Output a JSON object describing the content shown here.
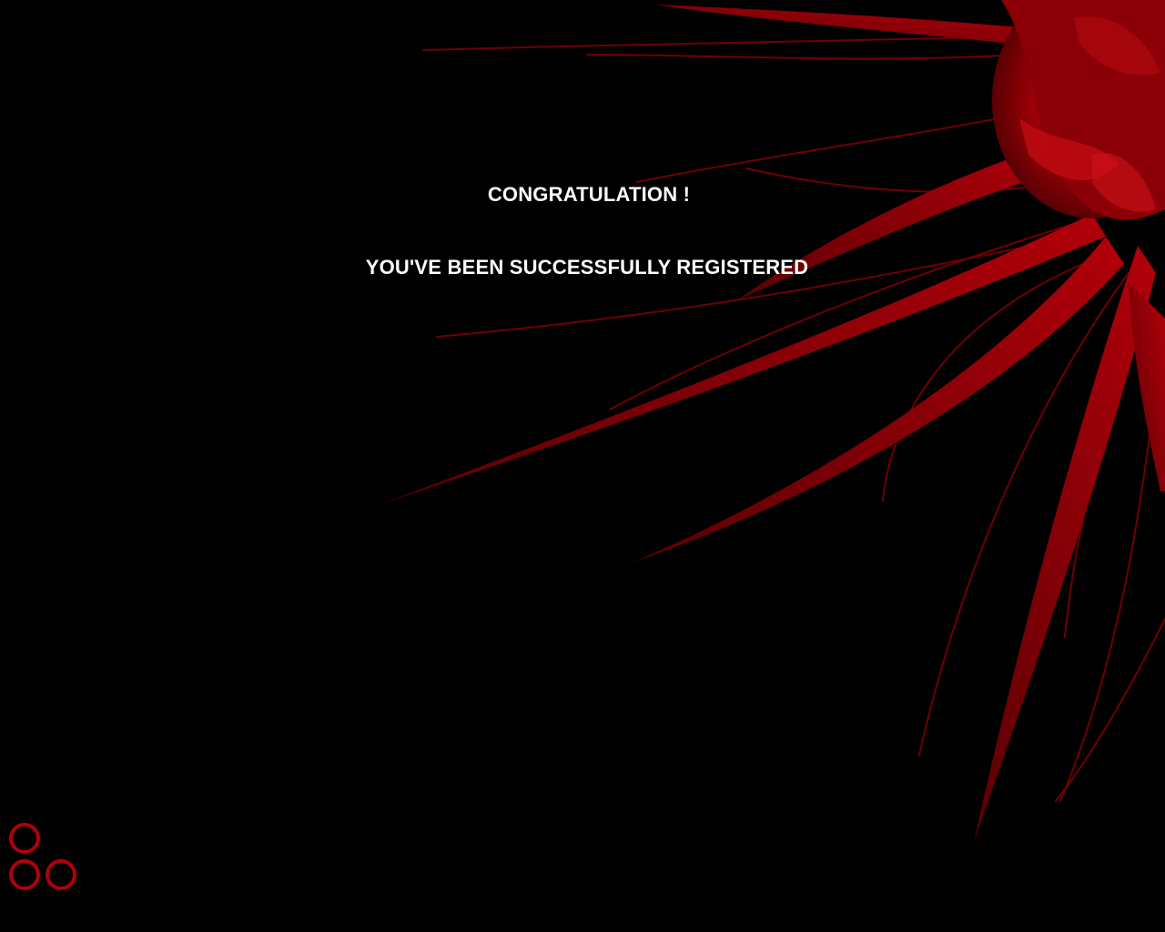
{
  "message": {
    "title": "CONGRATULATION !",
    "subtitle": "YOU'VE BEEN SUCCESSFULLY REGISTERED"
  },
  "colors": {
    "background": "#000000",
    "text": "#ffffff",
    "accent": "#c0000a"
  },
  "decorations": {
    "background_art": "red-tendrils-graphic",
    "corner_logo": "three-red-rings-logo"
  }
}
